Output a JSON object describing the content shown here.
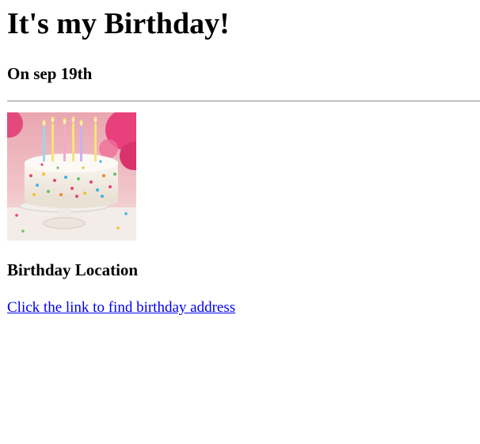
{
  "header": {
    "title": "It's my Birthday!",
    "subtitle": "On sep 19th"
  },
  "image": {
    "icon": "birthday-cake-photo"
  },
  "location": {
    "heading": "Birthday Location",
    "link_text": "Click the link to find birthday address"
  },
  "colors": {
    "link": "#0000ee",
    "text": "#000000",
    "background": "#ffffff"
  }
}
